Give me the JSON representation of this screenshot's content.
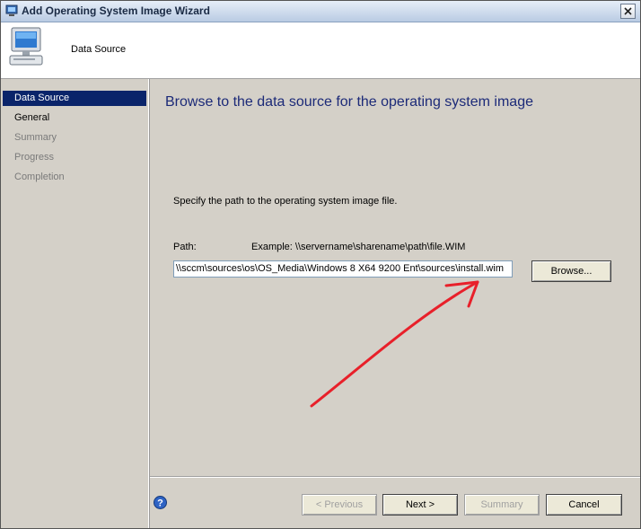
{
  "window": {
    "title": "Add Operating System Image Wizard"
  },
  "header": {
    "title": "Data Source"
  },
  "sidebar": {
    "items": [
      {
        "label": "Data Source",
        "state": "active"
      },
      {
        "label": "General",
        "state": "normal"
      },
      {
        "label": "Summary",
        "state": "disabled"
      },
      {
        "label": "Progress",
        "state": "disabled"
      },
      {
        "label": "Completion",
        "state": "disabled"
      }
    ]
  },
  "main": {
    "heading": "Browse to the data source for the operating system image",
    "instruction": "Specify the path to the operating system image file.",
    "path_label": "Path:",
    "example": "Example: \\\\servername\\sharename\\path\\file.WIM",
    "path_value": "\\\\sccm\\sources\\os\\OS_Media\\Windows 8 X64 9200 Ent\\sources\\install.wim",
    "browse_label": "Browse..."
  },
  "footer": {
    "previous_label": "< Previous",
    "next_label": "Next >",
    "summary_label": "Summary",
    "cancel_label": "Cancel"
  },
  "colors": {
    "accent": "#0a246a",
    "heading": "#1c2a78",
    "annotation_arrow": "#e8202a"
  }
}
